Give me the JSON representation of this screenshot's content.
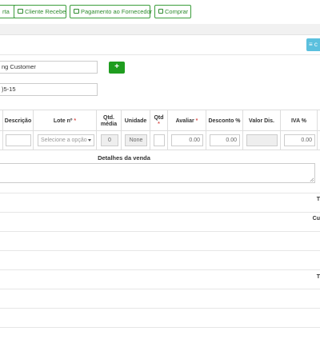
{
  "toolbar": {
    "buttons": [
      {
        "label": "rta"
      },
      {
        "label": "Cliente Recebe"
      },
      {
        "label": "Pagamento ao Fornecedor"
      },
      {
        "label": "Comprar"
      }
    ]
  },
  "list_button_label": "≡ c",
  "form": {
    "customer_value": "ng Customer",
    "add_label": "+",
    "date_value": ")5-15"
  },
  "table": {
    "headers": {
      "descricao": "Descrição",
      "lote": "Lote nº",
      "qtd_media_1": "Qtd.",
      "qtd_media_2": "média",
      "unidade": "Unidade",
      "qtd": "Qtd",
      "avaliar": "Avaliar",
      "desconto": "Desconto %",
      "valor_dis": "Valor Dis.",
      "iva": "IVA %",
      "required_mark": "*"
    },
    "row": {
      "descricao": "",
      "lote_placeholder": "Selecione a opção",
      "qtd_media": "0",
      "unidade": "None",
      "qtd": "",
      "avaliar": "0.00",
      "desconto": "0.00",
      "valor_dis": "",
      "iva": "0.00"
    }
  },
  "details_label": "Detalhes da venda",
  "right_labels": {
    "l1": "T",
    "l2": "Cu",
    "l3": "T"
  }
}
